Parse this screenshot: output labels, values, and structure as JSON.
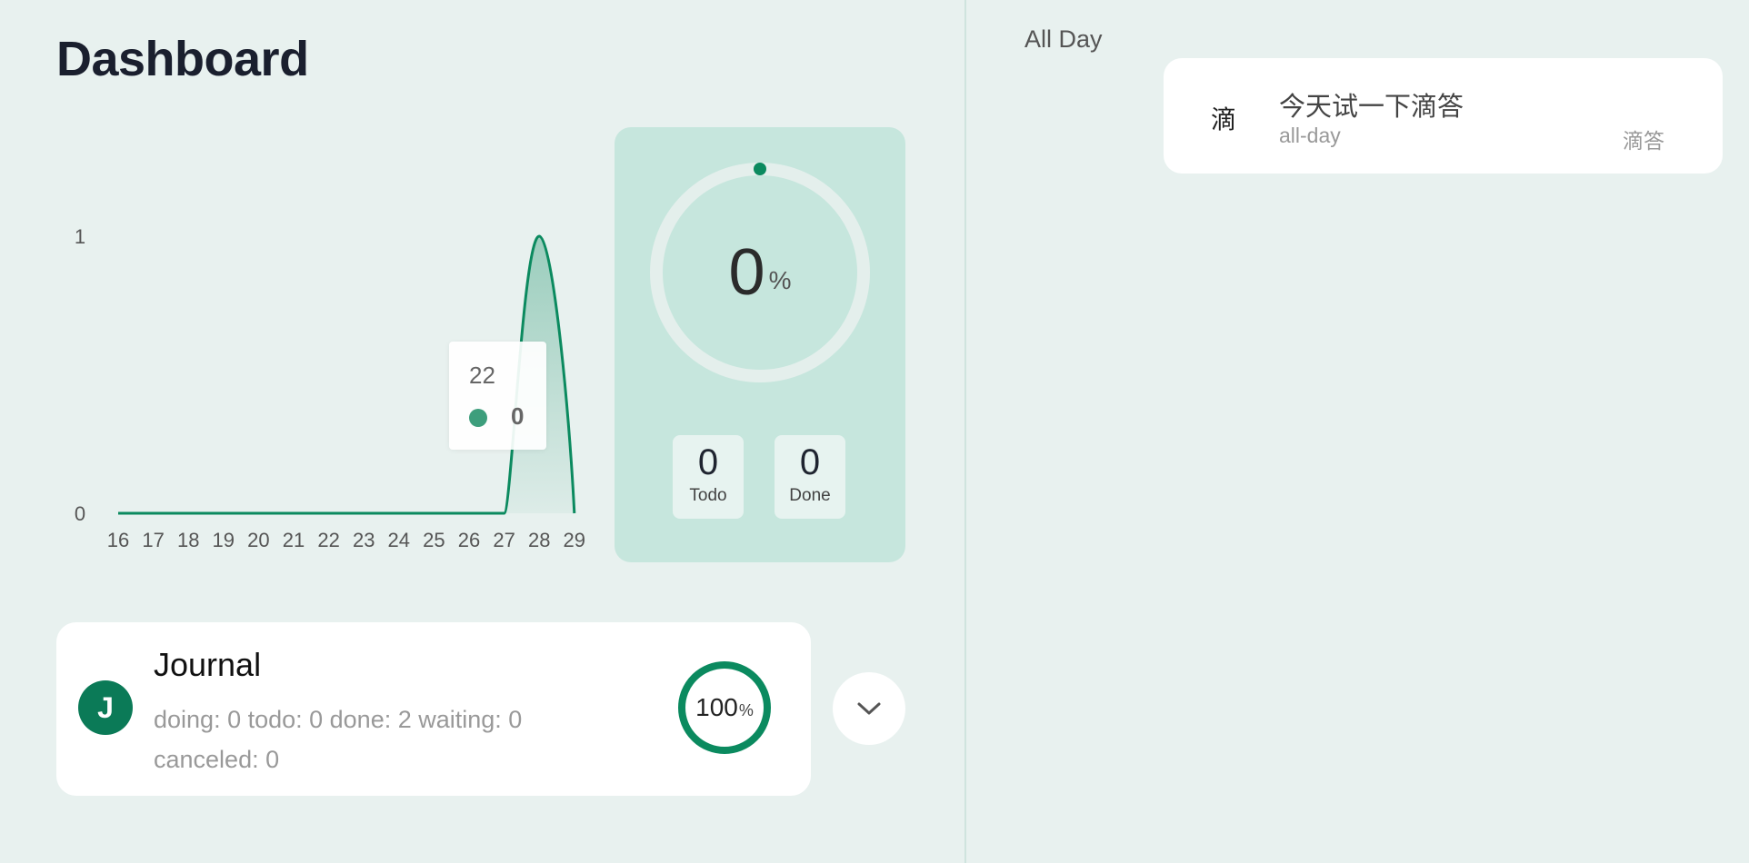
{
  "dashboard": {
    "title": "Dashboard"
  },
  "chart_data": {
    "type": "area",
    "x": [
      "16",
      "17",
      "18",
      "19",
      "20",
      "21",
      "22",
      "23",
      "24",
      "25",
      "26",
      "27",
      "28",
      "29"
    ],
    "series": [
      {
        "values": [
          0,
          0,
          0,
          0,
          0,
          0,
          0,
          0,
          0,
          0,
          0,
          0,
          1,
          0
        ]
      }
    ],
    "yticks": [
      "0",
      "1"
    ],
    "ylim": [
      0,
      1
    ],
    "grid": false,
    "color": "#0b8a5f",
    "tooltip": {
      "label": "22",
      "value": "0"
    }
  },
  "progress": {
    "value": "0",
    "unit": "%",
    "fraction": 0,
    "todo_count": "0",
    "todo_label": "Todo",
    "done_count": "0",
    "done_label": "Done"
  },
  "journal": {
    "avatar_letter": "J",
    "name": "Journal",
    "stats": "doing: 0 todo: 0 done: 2 waiting: 0 canceled: 0",
    "progress_value": "100",
    "progress_unit": "%",
    "progress_fraction": 1
  },
  "schedule": {
    "all_day_label": "All Day",
    "events": [
      {
        "icon": "滴",
        "title": "今天试一下滴答",
        "type": "all-day",
        "source": "滴答"
      }
    ]
  },
  "colors": {
    "accent": "#0b7a57",
    "card_bg": "#c6e6dd",
    "page_bg": "#e8f1ef"
  },
  "icons": {
    "expand": "chevron-down-icon"
  }
}
